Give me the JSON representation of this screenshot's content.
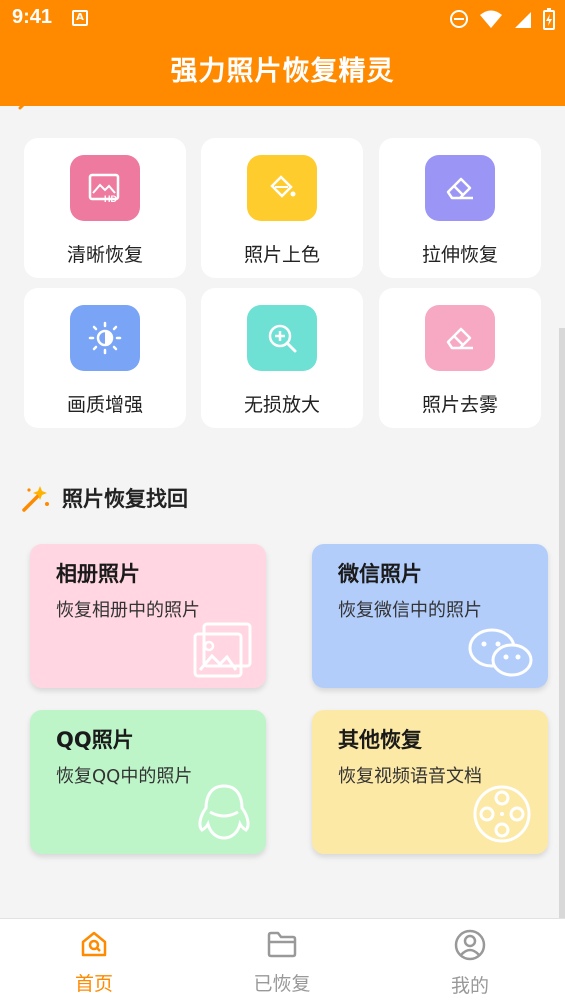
{
  "status_bar": {
    "time": "9:41",
    "notif_letter": "A"
  },
  "app_bar": {
    "title": "强力照片恢复精灵"
  },
  "tools": [
    {
      "label": "清晰恢复",
      "icon": "hd-image-icon",
      "color": "#ee7aa0"
    },
    {
      "label": "照片上色",
      "icon": "paint-bucket-icon",
      "color": "#ffcc2e"
    },
    {
      "label": "拉伸恢复",
      "icon": "eraser-icon",
      "color": "#9b95f5"
    },
    {
      "label": "画质增强",
      "icon": "brightness-icon",
      "color": "#7aa4f5"
    },
    {
      "label": "无损放大",
      "icon": "zoom-in-icon",
      "color": "#6ee0d4"
    },
    {
      "label": "照片去雾",
      "icon": "eraser-icon",
      "color": "#f7a9c3"
    }
  ],
  "section": {
    "title": "照片恢复找回"
  },
  "cards": [
    {
      "title": "相册照片",
      "subtitle": "恢复相册中的照片",
      "bg": "#ffd6e2",
      "icon": "gallery-icon"
    },
    {
      "title": "微信照片",
      "subtitle": "恢复微信中的照片",
      "bg": "#b3cdfb",
      "icon": "wechat-icon"
    },
    {
      "title": "QQ照片",
      "subtitle": "恢复QQ中的照片",
      "bg": "#bdf5c9",
      "icon": "qq-icon"
    },
    {
      "title": "其他恢复",
      "subtitle": "恢复视频语音文档",
      "bg": "#fde9a6",
      "icon": "film-reel-icon"
    }
  ],
  "nav": [
    {
      "label": "首页",
      "icon": "home-icon",
      "active": true
    },
    {
      "label": "已恢复",
      "icon": "folder-icon",
      "active": false
    },
    {
      "label": "我的",
      "icon": "user-icon",
      "active": false
    }
  ],
  "colors": {
    "brand": "#ff8a00",
    "nav_active": "#ff8a00",
    "nav_inactive": "#999999"
  }
}
